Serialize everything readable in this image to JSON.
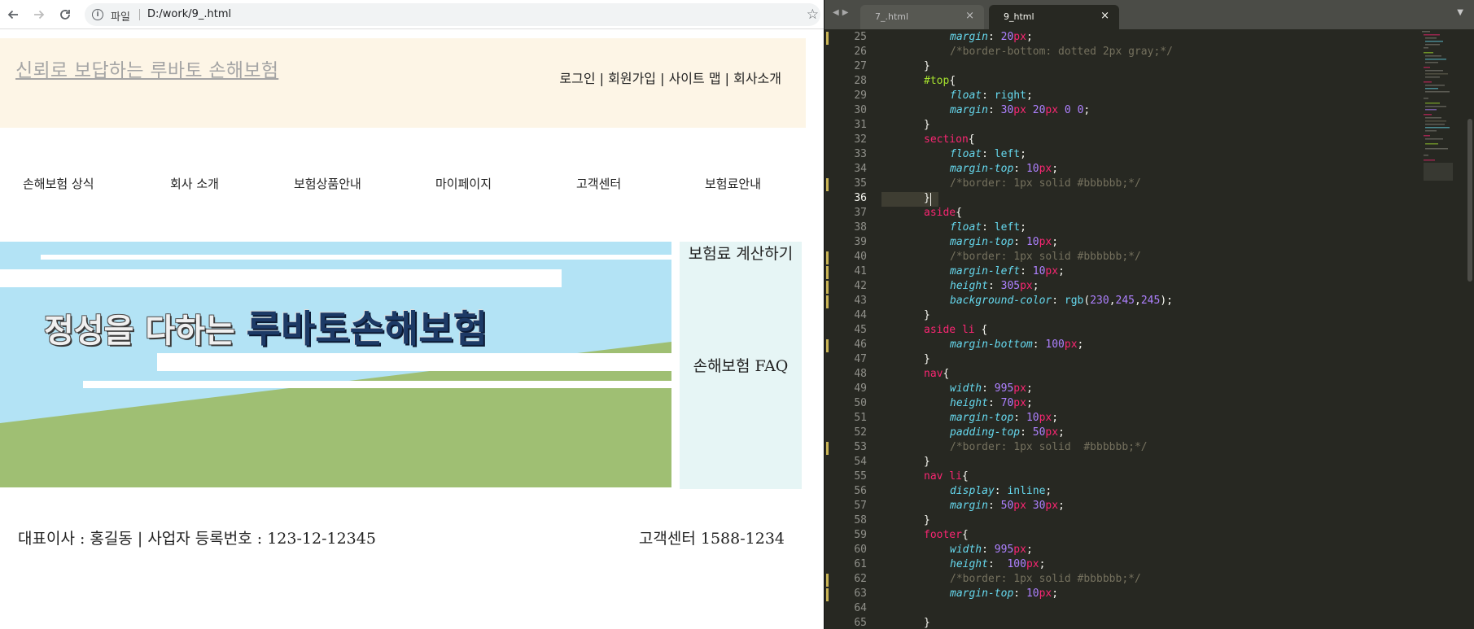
{
  "browser": {
    "url_scheme_label": "파일",
    "url": "D:/work/9_.html"
  },
  "site": {
    "title": "신뢰로 보답하는 루바토 손해보험",
    "top_links": "로그인 | 회원가입 | 사이트 맵 | 회사소개",
    "nav": [
      "손해보험 상식",
      "회사 소개",
      "보험상품안내",
      "마이페이지",
      "고객센터",
      "보험료안내"
    ],
    "banner": {
      "text_light": "정성을 다하는 ",
      "text_dark": "루바토손해보험",
      "colors": {
        "sky": "#b3e3f5",
        "grass": "#9fbf73",
        "stripe": "#ffffff",
        "text_dark": "#1d3a66"
      }
    },
    "aside": [
      "보험료 계산하기",
      "손해보험 FAQ"
    ],
    "footer": {
      "left": "대표이사 : 홍길동 | 사업자 등록번호 : 123-12-12345",
      "right": "고객센터 1588-1234"
    },
    "colors": {
      "header_bg": "#fdf5e6",
      "aside_bg": "#e6f5f5"
    }
  },
  "editor": {
    "tabs": [
      {
        "label": "7_.html",
        "active": false
      },
      {
        "label": "9_html",
        "active": true
      }
    ],
    "active_line": 36,
    "lines": [
      {
        "n": 25,
        "t": [
          [
            "prop",
            "margin"
          ],
          [
            "p",
            ": "
          ],
          [
            "num",
            "20"
          ],
          [
            "unit",
            "px"
          ],
          [
            "p",
            ";"
          ]
        ],
        "i": 2
      },
      {
        "n": 26,
        "t": [
          [
            "com",
            "/*border-bottom: dotted 2px gray;*/"
          ]
        ],
        "i": 2
      },
      {
        "n": 27,
        "t": [
          [
            "p",
            "}"
          ]
        ],
        "i": 1
      },
      {
        "n": 28,
        "t": [
          [
            "id",
            "#top"
          ],
          [
            "p",
            "{"
          ]
        ],
        "i": 1
      },
      {
        "n": 29,
        "t": [
          [
            "prop",
            "float"
          ],
          [
            "p",
            ": "
          ],
          [
            "val",
            "right"
          ],
          [
            "p",
            ";"
          ]
        ],
        "i": 2
      },
      {
        "n": 30,
        "t": [
          [
            "prop",
            "margin"
          ],
          [
            "p",
            ": "
          ],
          [
            "num",
            "30"
          ],
          [
            "unit",
            "px"
          ],
          [
            "p",
            " "
          ],
          [
            "num",
            "20"
          ],
          [
            "unit",
            "px"
          ],
          [
            "p",
            " "
          ],
          [
            "num",
            "0"
          ],
          [
            "p",
            " "
          ],
          [
            "num",
            "0"
          ],
          [
            "p",
            ";"
          ]
        ],
        "i": 2
      },
      {
        "n": 31,
        "t": [
          [
            "p",
            "}"
          ]
        ],
        "i": 1
      },
      {
        "n": 32,
        "t": [
          [
            "sel",
            "section"
          ],
          [
            "p",
            "{"
          ]
        ],
        "i": 1
      },
      {
        "n": 33,
        "t": [
          [
            "prop",
            "float"
          ],
          [
            "p",
            ": "
          ],
          [
            "val",
            "left"
          ],
          [
            "p",
            ";"
          ]
        ],
        "i": 2
      },
      {
        "n": 34,
        "t": [
          [
            "prop",
            "margin-top"
          ],
          [
            "p",
            ": "
          ],
          [
            "num",
            "10"
          ],
          [
            "unit",
            "px"
          ],
          [
            "p",
            ";"
          ]
        ],
        "i": 2
      },
      {
        "n": 35,
        "t": [
          [
            "com",
            "/*border: 1px solid #bbbbbb;*/"
          ]
        ],
        "i": 2
      },
      {
        "n": 36,
        "t": [
          [
            "p",
            "}"
          ]
        ],
        "i": 1
      },
      {
        "n": 37,
        "t": [
          [
            "sel",
            "aside"
          ],
          [
            "p",
            "{"
          ]
        ],
        "i": 1
      },
      {
        "n": 38,
        "t": [
          [
            "prop",
            "float"
          ],
          [
            "p",
            ": "
          ],
          [
            "val",
            "left"
          ],
          [
            "p",
            ";"
          ]
        ],
        "i": 2
      },
      {
        "n": 39,
        "t": [
          [
            "prop",
            "margin-top"
          ],
          [
            "p",
            ": "
          ],
          [
            "num",
            "10"
          ],
          [
            "unit",
            "px"
          ],
          [
            "p",
            ";"
          ]
        ],
        "i": 2
      },
      {
        "n": 40,
        "t": [
          [
            "com",
            "/*border: 1px solid #bbbbbb;*/"
          ]
        ],
        "i": 2
      },
      {
        "n": 41,
        "t": [
          [
            "prop",
            "margin-left"
          ],
          [
            "p",
            ": "
          ],
          [
            "num",
            "10"
          ],
          [
            "unit",
            "px"
          ],
          [
            "p",
            ";"
          ]
        ],
        "i": 2
      },
      {
        "n": 42,
        "t": [
          [
            "prop",
            "height"
          ],
          [
            "p",
            ": "
          ],
          [
            "num",
            "305"
          ],
          [
            "unit",
            "px"
          ],
          [
            "p",
            ";"
          ]
        ],
        "i": 2
      },
      {
        "n": 43,
        "t": [
          [
            "prop",
            "background-color"
          ],
          [
            "p",
            ": "
          ],
          [
            "val",
            "rgb"
          ],
          [
            "p",
            "("
          ],
          [
            "num",
            "230"
          ],
          [
            "p",
            ","
          ],
          [
            "num",
            "245"
          ],
          [
            "p",
            ","
          ],
          [
            "num",
            "245"
          ],
          [
            "p",
            ");"
          ]
        ],
        "i": 2
      },
      {
        "n": 44,
        "t": [
          [
            "p",
            "}"
          ]
        ],
        "i": 1
      },
      {
        "n": 45,
        "t": [
          [
            "sel",
            "aside li"
          ],
          [
            "p",
            " {"
          ]
        ],
        "i": 1
      },
      {
        "n": 46,
        "t": [
          [
            "prop",
            "margin-bottom"
          ],
          [
            "p",
            ": "
          ],
          [
            "num",
            "100"
          ],
          [
            "unit",
            "px"
          ],
          [
            "p",
            ";"
          ]
        ],
        "i": 2
      },
      {
        "n": 47,
        "t": [
          [
            "p",
            "}"
          ]
        ],
        "i": 1
      },
      {
        "n": 48,
        "t": [
          [
            "sel",
            "nav"
          ],
          [
            "p",
            "{"
          ]
        ],
        "i": 1
      },
      {
        "n": 49,
        "t": [
          [
            "prop",
            "width"
          ],
          [
            "p",
            ": "
          ],
          [
            "num",
            "995"
          ],
          [
            "unit",
            "px"
          ],
          [
            "p",
            ";"
          ]
        ],
        "i": 2
      },
      {
        "n": 50,
        "t": [
          [
            "prop",
            "height"
          ],
          [
            "p",
            ": "
          ],
          [
            "num",
            "70"
          ],
          [
            "unit",
            "px"
          ],
          [
            "p",
            ";"
          ]
        ],
        "i": 2
      },
      {
        "n": 51,
        "t": [
          [
            "prop",
            "margin-top"
          ],
          [
            "p",
            ": "
          ],
          [
            "num",
            "10"
          ],
          [
            "unit",
            "px"
          ],
          [
            "p",
            ";"
          ]
        ],
        "i": 2
      },
      {
        "n": 52,
        "t": [
          [
            "prop",
            "padding-top"
          ],
          [
            "p",
            ": "
          ],
          [
            "num",
            "50"
          ],
          [
            "unit",
            "px"
          ],
          [
            "p",
            ";"
          ]
        ],
        "i": 2
      },
      {
        "n": 53,
        "t": [
          [
            "com",
            "/*border: 1px solid  #bbbbbb;*/"
          ]
        ],
        "i": 2
      },
      {
        "n": 54,
        "t": [
          [
            "p",
            "}"
          ]
        ],
        "i": 1
      },
      {
        "n": 55,
        "t": [
          [
            "sel",
            "nav li"
          ],
          [
            "p",
            "{"
          ]
        ],
        "i": 1
      },
      {
        "n": 56,
        "t": [
          [
            "prop",
            "display"
          ],
          [
            "p",
            ": "
          ],
          [
            "val",
            "inline"
          ],
          [
            "p",
            ";"
          ]
        ],
        "i": 2
      },
      {
        "n": 57,
        "t": [
          [
            "prop",
            "margin"
          ],
          [
            "p",
            ": "
          ],
          [
            "num",
            "50"
          ],
          [
            "unit",
            "px"
          ],
          [
            "p",
            " "
          ],
          [
            "num",
            "30"
          ],
          [
            "unit",
            "px"
          ],
          [
            "p",
            ";"
          ]
        ],
        "i": 2
      },
      {
        "n": 58,
        "t": [
          [
            "p",
            "}"
          ]
        ],
        "i": 1
      },
      {
        "n": 59,
        "t": [
          [
            "sel",
            "footer"
          ],
          [
            "p",
            "{"
          ]
        ],
        "i": 1
      },
      {
        "n": 60,
        "t": [
          [
            "prop",
            "width"
          ],
          [
            "p",
            ": "
          ],
          [
            "num",
            "995"
          ],
          [
            "unit",
            "px"
          ],
          [
            "p",
            ";"
          ]
        ],
        "i": 2
      },
      {
        "n": 61,
        "t": [
          [
            "prop",
            "height"
          ],
          [
            "p",
            ":  "
          ],
          [
            "num",
            "100"
          ],
          [
            "unit",
            "px"
          ],
          [
            "p",
            ";"
          ]
        ],
        "i": 2
      },
      {
        "n": 62,
        "t": [
          [
            "com",
            "/*border: 1px solid #bbbbbb;*/"
          ]
        ],
        "i": 2
      },
      {
        "n": 63,
        "t": [
          [
            "prop",
            "margin-top"
          ],
          [
            "p",
            ": "
          ],
          [
            "num",
            "10"
          ],
          [
            "unit",
            "px"
          ],
          [
            "p",
            ";"
          ]
        ],
        "i": 2
      },
      {
        "n": 64,
        "t": [],
        "i": 0
      },
      {
        "n": 65,
        "t": [
          [
            "p",
            "}"
          ]
        ],
        "i": 1
      }
    ],
    "modified_lines": [
      25,
      35,
      40,
      41,
      42,
      43,
      46,
      53,
      62,
      63
    ]
  }
}
